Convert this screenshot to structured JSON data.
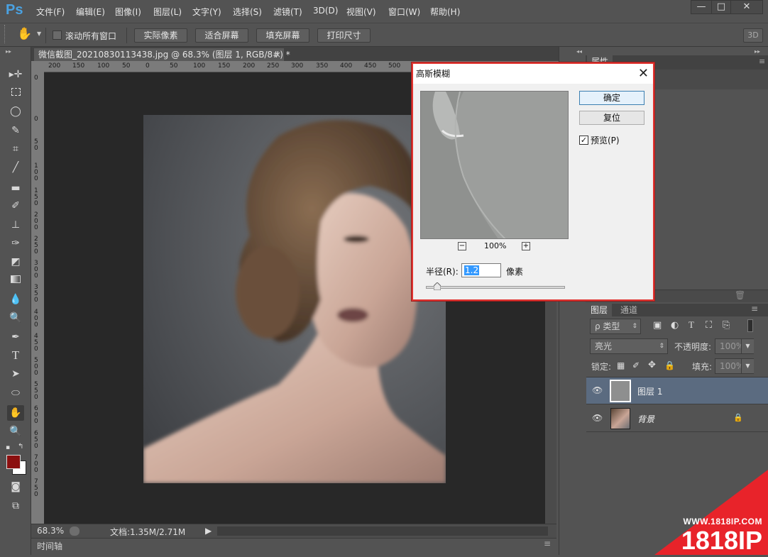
{
  "app": {
    "logo": "Ps"
  },
  "menu": [
    "文件(F)",
    "编辑(E)",
    "图像(I)",
    "图层(L)",
    "文字(Y)",
    "选择(S)",
    "滤镜(T)",
    "3D(D)",
    "视图(V)",
    "窗口(W)",
    "帮助(H)"
  ],
  "window_buttons": {
    "min": "—",
    "max": "□",
    "close": "✕"
  },
  "options": {
    "scroll_all": "滚动所有窗口",
    "actual_pixels": "实际像素",
    "fit_screen": "适合屏幕",
    "fill_screen": "填充屏幕",
    "print_size": "打印尺寸",
    "threed": "3D"
  },
  "document": {
    "tab_title": "微信截图_20210830113438.jpg @ 68.3% (图层 1, RGB/8#) *",
    "tab_close": "×",
    "ruler_h": [
      "200",
      "150",
      "100",
      "50",
      "0",
      "50",
      "100",
      "150",
      "200",
      "250",
      "300",
      "350",
      "400",
      "450",
      "500"
    ],
    "ruler_v": [
      "0",
      "5 0",
      "1 0 0",
      "1 5 0",
      "2 0 0",
      "2 5 0",
      "3 0 0",
      "3 5 0",
      "4 0 0",
      "4 5 0",
      "5 0 0",
      "5 5 0",
      "6 0 0",
      "6 5 0",
      "7 0 0",
      "7 5 0"
    ]
  },
  "status": {
    "zoom": "68.3%",
    "doc_size": "文档:1.35M/2.71M",
    "arrow": "▶"
  },
  "timeline": {
    "label": "时间轴"
  },
  "properties_tab": "属性",
  "layers_panel": {
    "tabs": [
      "图层",
      "通道"
    ],
    "filter_kind": "ρ 类型",
    "blend_mode": "亮光",
    "opacity_label": "不透明度:",
    "opacity_value": "100%",
    "lock_label": "锁定:",
    "fill_label": "填充:",
    "fill_value": "100%",
    "layers": [
      {
        "name": "图层 1",
        "selected": true
      },
      {
        "name": "背景",
        "selected": false,
        "locked": true
      }
    ]
  },
  "dialog": {
    "title": "高斯模糊",
    "ok": "确定",
    "reset": "复位",
    "preview_label": "预览(P)",
    "preview_checked": true,
    "zoom": "100%",
    "zoom_out": "−",
    "zoom_in": "+",
    "radius_label": "半径(R):",
    "radius_value": "1.2",
    "unit": "像素",
    "slider_fraction": 0.06
  },
  "watermark": {
    "url": "WWW.1818IP.COM",
    "brand": "1818IP"
  },
  "colors": {
    "accent": "#4aa2e2",
    "dialog_border": "#e0322e",
    "foreground": "#8b0f0f",
    "background": "#ffffff"
  }
}
